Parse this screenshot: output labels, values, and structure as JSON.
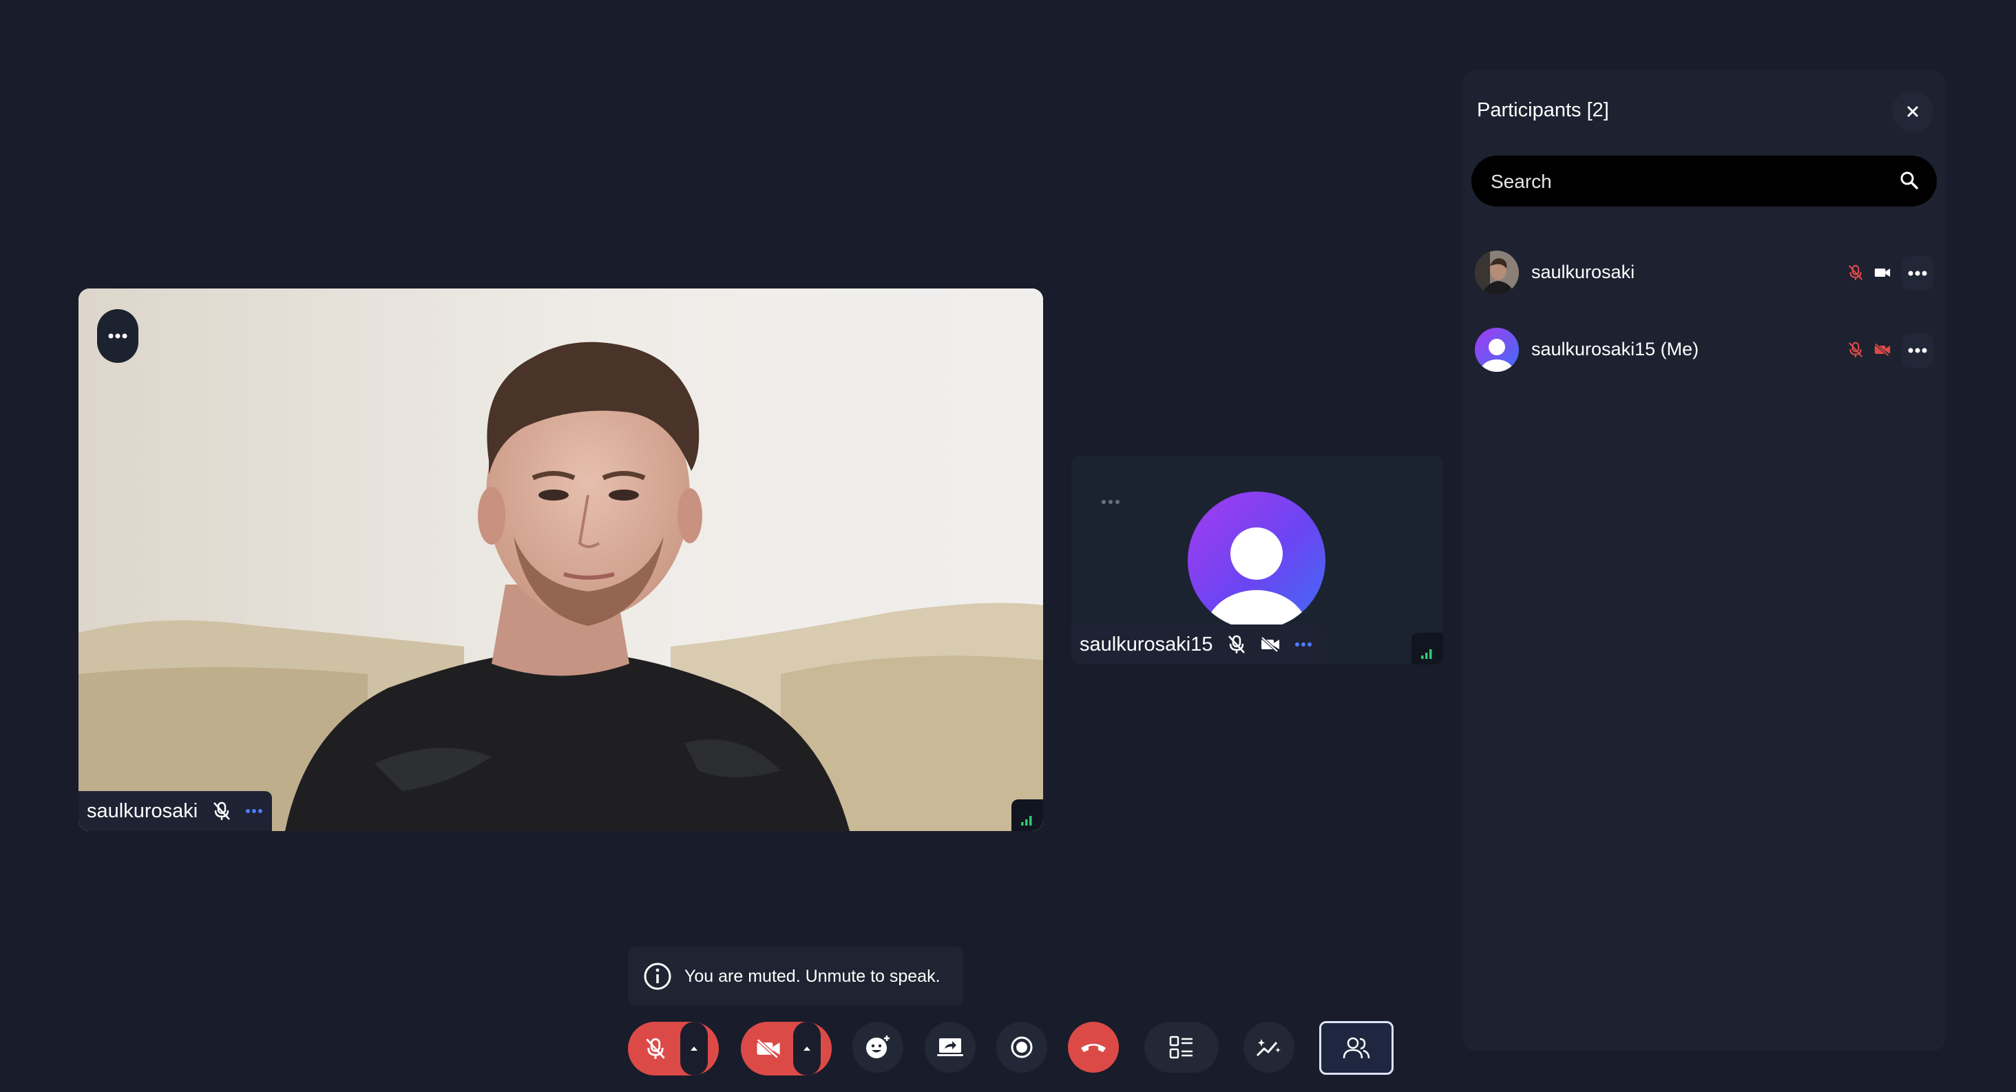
{
  "main_tile": {
    "participant_name": "saulkurosaki"
  },
  "small_tile": {
    "participant_name": "saulkurosaki15"
  },
  "participants_panel": {
    "title": "Participants [2]",
    "search_placeholder": "Search",
    "participants": [
      {
        "name": "saulkurosaki",
        "mic": "muted",
        "camera": "on"
      },
      {
        "name": "saulkurosaki15 (Me)",
        "mic": "muted",
        "camera": "off"
      }
    ]
  },
  "toast": {
    "message": "You are muted. Unmute to speak."
  },
  "toolbar": {
    "buttons": [
      "mic-toggle",
      "camera-toggle",
      "reactions",
      "share-screen",
      "record",
      "leave-call",
      "layout",
      "effects",
      "participants"
    ]
  },
  "colors": {
    "background": "#191c2a",
    "panel": "#1d2130",
    "danger": "#dc4a48",
    "accent_blue": "#4f7cff",
    "signal_green": "#2ecc71",
    "avatar_gradient_start": "#a33cf0",
    "avatar_gradient_end": "#3f6ef5"
  }
}
